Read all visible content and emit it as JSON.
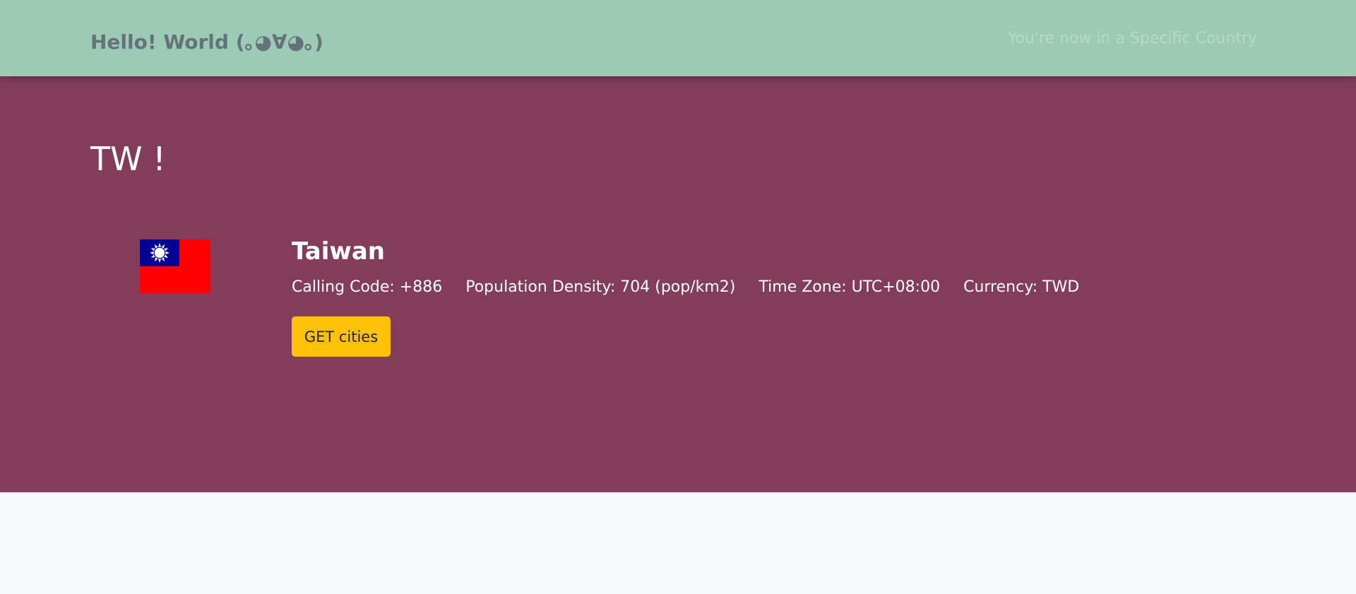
{
  "navbar": {
    "brand": "Hello! World (｡◕∀◕｡)",
    "note": "You're now in a Specific Country",
    "background": "#9ccab5"
  },
  "hero": {
    "background": "#833d5b",
    "heading": "TW !"
  },
  "country": {
    "name": "Taiwan",
    "flag_icon": "taiwan-flag-icon",
    "facts": [
      "Calling Code: +886",
      "Population Density: 704 (pop/km2)",
      "Time Zone: UTC+08:00",
      "Currency: TWD"
    ],
    "button_label": "GET cities",
    "button_color": "#ffc107"
  }
}
